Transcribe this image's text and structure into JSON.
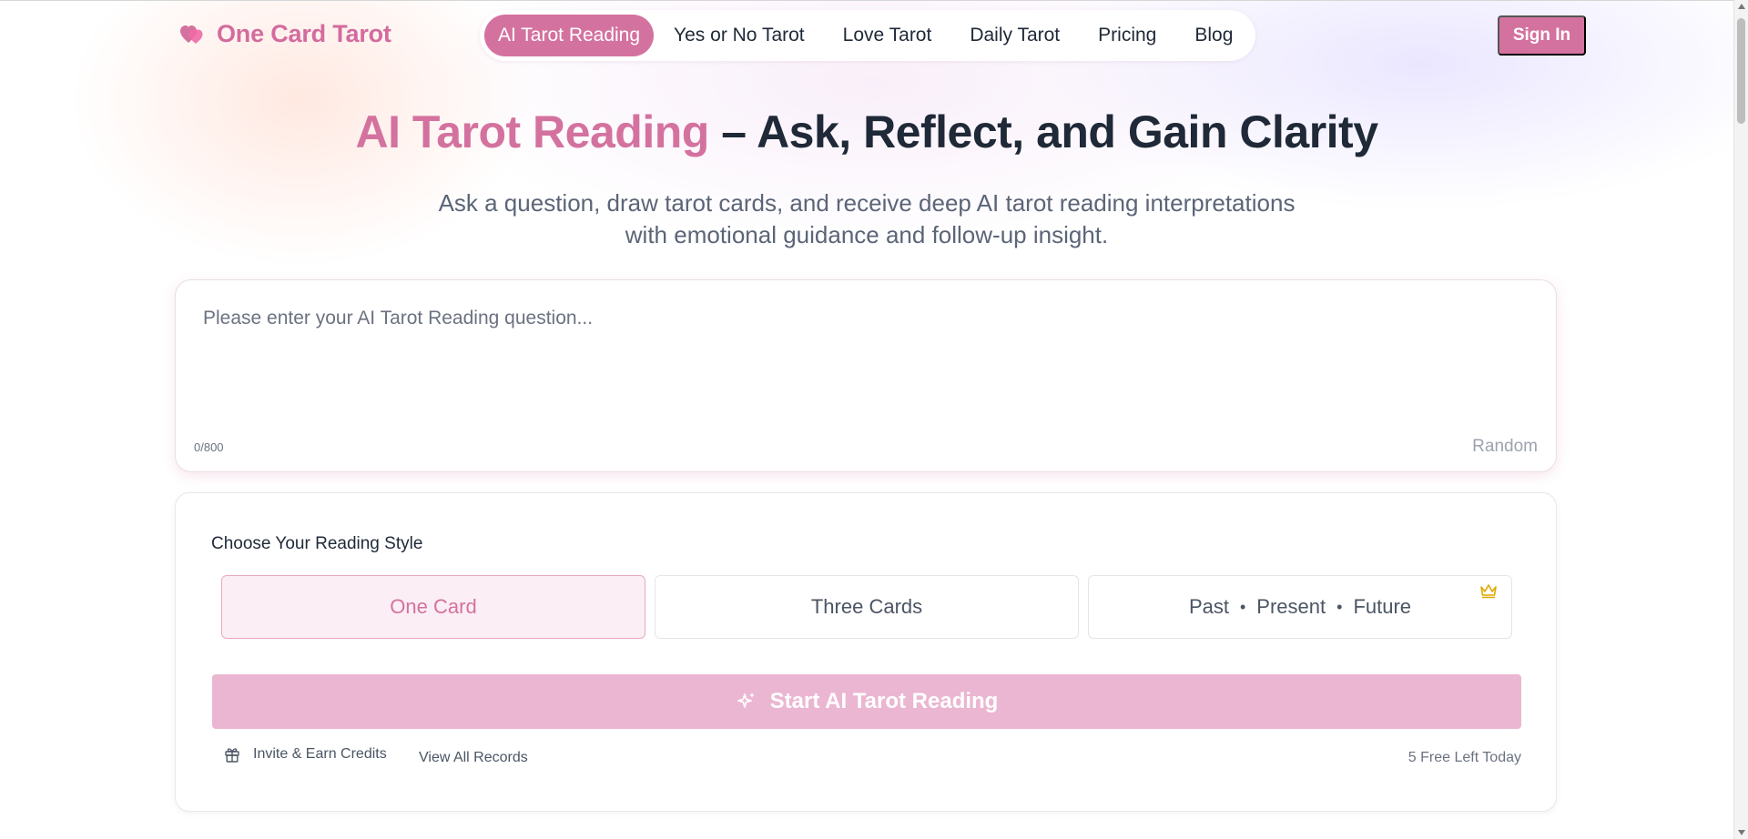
{
  "brand": {
    "name": "One Card Tarot",
    "icon": "hearts-icon"
  },
  "nav": {
    "items": [
      {
        "label": "AI Tarot Reading",
        "active": true
      },
      {
        "label": "Yes or No Tarot"
      },
      {
        "label": "Love Tarot"
      },
      {
        "label": "Daily Tarot"
      },
      {
        "label": "Pricing"
      },
      {
        "label": "Blog"
      }
    ]
  },
  "header": {
    "signin_label": "Sign In"
  },
  "hero": {
    "title_accent": "AI Tarot Reading",
    "title_dash": " – ",
    "title_rest": "Ask, Reflect, and Gain Clarity",
    "subtitle_line1": "Ask a question, draw tarot cards, and receive deep AI tarot reading interpretations",
    "subtitle_line2": "with emotional guidance and follow-up insight."
  },
  "question": {
    "placeholder": "Please enter your AI Tarot Reading question...",
    "value": "",
    "counter": "0/800",
    "random_label": "Random"
  },
  "reading_style": {
    "label": "Choose Your Reading Style",
    "options": {
      "one_card": "One Card",
      "three_cards": "Three Cards",
      "past": "Past",
      "present": "Present",
      "future": "Future",
      "separator": "•"
    },
    "selected": "One Card",
    "premium_icon": "crown-icon"
  },
  "actions": {
    "start_label": "Start AI Tarot Reading",
    "invite_label": "Invite & Earn Credits",
    "records_label": "View All Records",
    "free_left": "5 Free Left Today"
  },
  "colors": {
    "accent": "#d4729f",
    "accent_light": "#ebb6d1",
    "selected_bg": "#fbeef4",
    "crown": "#e0a800"
  }
}
